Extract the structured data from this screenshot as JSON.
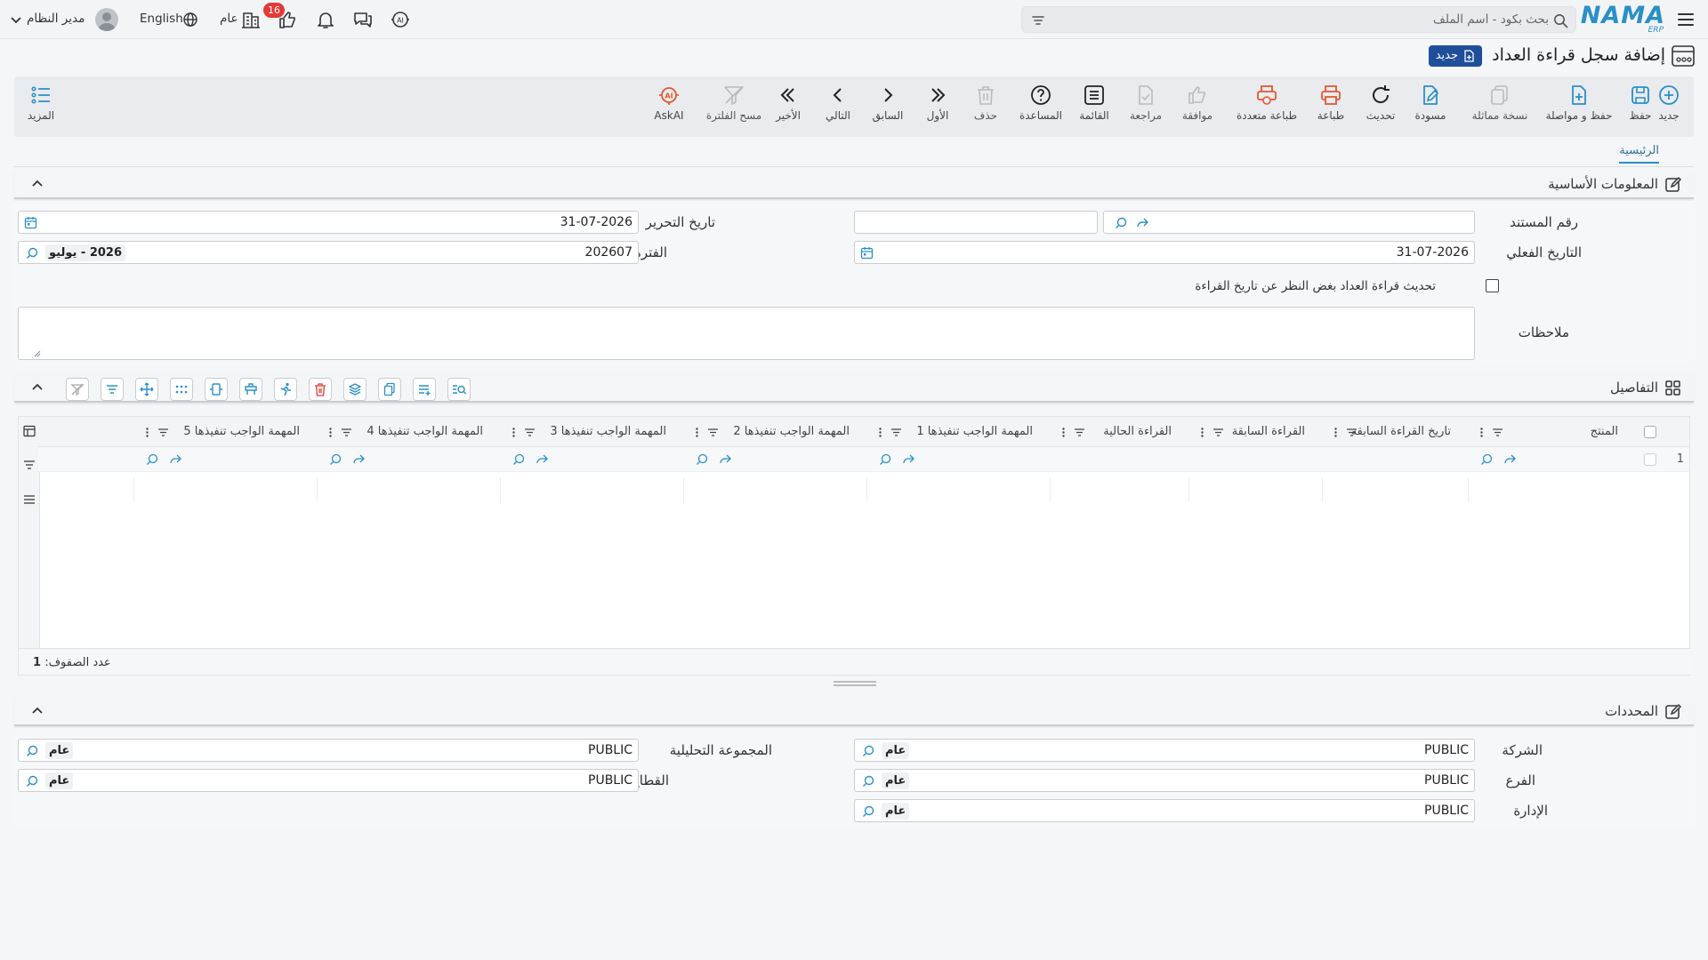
{
  "topbar": {
    "logo_text": "NAMA",
    "logo_sub": "ERP",
    "search_placeholder": "بحث بكود - اسم الملف",
    "user_name": "مدير النظام",
    "language": "English",
    "scope": "عام",
    "notification_count": "16"
  },
  "page": {
    "title": "إضافة سجل قراءة العداد",
    "status_badge": "جديد"
  },
  "toolbar": {
    "new": "جديد",
    "save": "حفظ",
    "save_continue": "حفظ و مواصلة",
    "duplicate": "نسخة مماثلة",
    "draft": "مسودة",
    "refresh": "تحديث",
    "print": "طباعة",
    "multi_print": "طباعة متعددة",
    "approve": "موافقة",
    "review": "مراجعة",
    "list": "القائمة",
    "help": "المساعدة",
    "delete": "حذف",
    "first": "الأول",
    "previous": "السابق",
    "next": "التالي",
    "last": "الأخير",
    "clear_filter": "مسح الفلترة",
    "ask_ai": "AskAI",
    "more": "المزيد"
  },
  "tabs": {
    "main": "الرئيسية"
  },
  "basic_info": {
    "title": "المعلومات الأساسية",
    "doc_number_label": "رقم المستند",
    "doc_number_value": "",
    "edit_date_label": "تاريخ التحرير",
    "edit_date_value": "31-07-2026",
    "actual_date_label": "التاريخ الفعلي",
    "actual_date_value": "31-07-2026",
    "period_label": "الفترة",
    "period_value": "202607",
    "period_chip": "2026 - يوليو",
    "update_checkbox_label": "تحديث قراءة العداد بغض النظر عن تاريخ القراءة",
    "notes_label": "ملاحظات",
    "notes_value": ""
  },
  "details": {
    "title": "التفاصيل",
    "columns": [
      "المنتج",
      "تاريخ القراءة السابقة",
      "القراءة السابقة",
      "القراءة الحالية",
      "المهمة الواجب تنفيذها 1",
      "المهمة الواجب تنفيذها 2",
      "المهمة الواجب تنفيذها 3",
      "المهمة الواجب تنفيذها 4",
      "المهمة الواجب تنفيذها 5"
    ],
    "row_number": "1",
    "row_count_label": "عدد الصفوف:",
    "row_count_value": "1"
  },
  "dimensions": {
    "title": "المحددات",
    "company_label": "الشركة",
    "company_value": "PUBLIC",
    "company_chip": "عام",
    "branch_label": "الفرع",
    "branch_value": "PUBLIC",
    "branch_chip": "عام",
    "department_label": "الإدارة",
    "department_value": "PUBLIC",
    "department_chip": "عام",
    "analysis_group_label": "المجموعة التحليلية",
    "analysis_group_value": "PUBLIC",
    "analysis_group_chip": "عام",
    "sector_label": "القطاع",
    "sector_value": "PUBLIC",
    "sector_chip": "عام"
  },
  "colors": {
    "brand": "#2a8fc9",
    "badge_blue": "#1f4f9a",
    "print_orange": "#e4572e",
    "notification_red": "#e53935"
  }
}
